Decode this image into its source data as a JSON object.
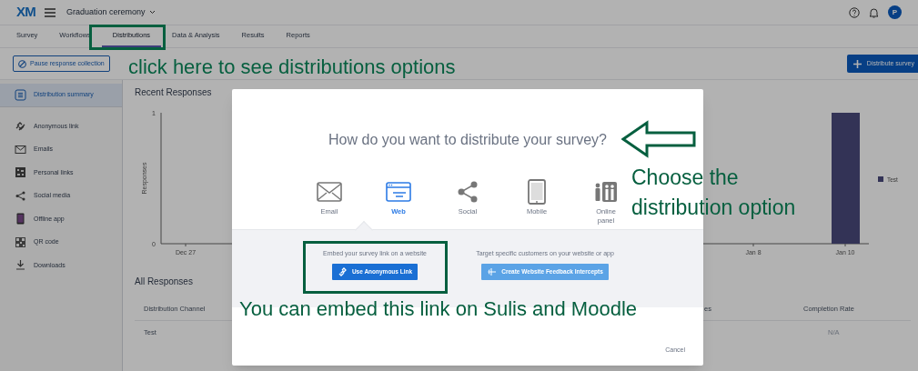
{
  "header": {
    "logo": "XM",
    "survey_title": "Graduation ceremony",
    "avatar": "P"
  },
  "tabs": [
    {
      "label": "Survey",
      "selected": false
    },
    {
      "label": "Workflows",
      "selected": false
    },
    {
      "label": "Distributions",
      "selected": true
    },
    {
      "label": "Data & Analysis",
      "selected": false
    },
    {
      "label": "Results",
      "selected": false
    },
    {
      "label": "Reports",
      "selected": false
    }
  ],
  "toolbar": {
    "pause_button": "Pause response collection",
    "distribute_button": "Distribute survey"
  },
  "sidebar": {
    "items": [
      {
        "label": "Distribution summary",
        "selected": true
      },
      {
        "label": "Anonymous link",
        "selected": false
      },
      {
        "label": "Emails",
        "selected": false
      },
      {
        "label": "Personal links",
        "selected": false
      },
      {
        "label": "Social media",
        "selected": false
      },
      {
        "label": "Offline app",
        "selected": false
      },
      {
        "label": "QR code",
        "selected": false
      },
      {
        "label": "Downloads",
        "selected": false
      }
    ]
  },
  "recent_responses": {
    "title": "Recent Responses",
    "chart_data": {
      "type": "bar",
      "ylabel": "Responses",
      "categories": [
        "Dec 27",
        "Jan 8",
        "Jan 10"
      ],
      "series": [
        {
          "name": "Test",
          "color": "#4a4a7c",
          "values": [
            0,
            0,
            1
          ]
        }
      ],
      "ylim": [
        0,
        1
      ],
      "yticks": [
        0,
        1
      ]
    }
  },
  "all_responses": {
    "title": "All Responses",
    "columns": [
      "Distribution Channel",
      "es",
      "Completion Rate"
    ],
    "rows": [
      {
        "distribution_channel": "Test",
        "completion_rate": "N/A"
      }
    ]
  },
  "modal": {
    "question": "How do you want to distribute your survey?",
    "options": [
      {
        "label": "Email",
        "selected": false
      },
      {
        "label": "Web",
        "selected": true
      },
      {
        "label": "Social",
        "selected": false
      },
      {
        "label": "Mobile",
        "selected": false
      },
      {
        "label": "Online panel",
        "selected": false
      }
    ],
    "sections": [
      {
        "text": "Embed your survey link on a website",
        "button": "Use Anonymous Link",
        "kind": "primary"
      },
      {
        "text": "Target specific customers on your website or app",
        "button": "Create Website Feedback Intercepts",
        "kind": "secondary"
      }
    ],
    "cancel": "Cancel"
  },
  "annotations": [
    {
      "kind": "tabs",
      "text": "click here to see distributions options"
    },
    {
      "kind": "arrow",
      "text": "Choose the distribution option"
    },
    {
      "kind": "section",
      "text": "You can embed this link on Sulis and Moodle"
    }
  ]
}
